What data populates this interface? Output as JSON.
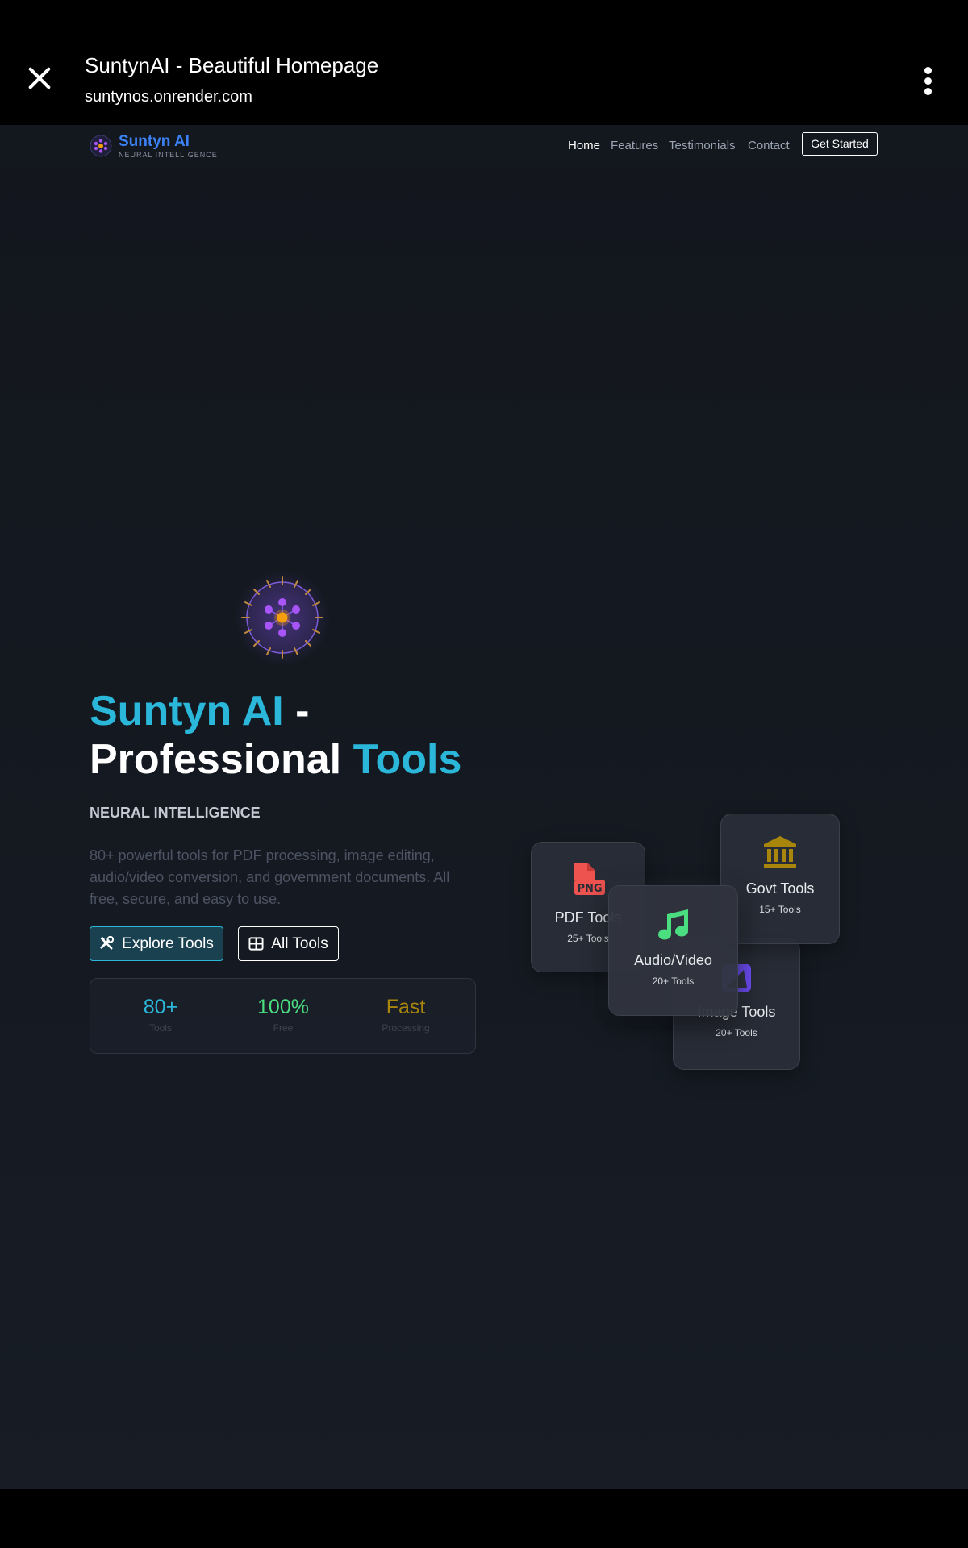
{
  "browser": {
    "title": "SuntynAI - Beautiful Homepage",
    "url": "suntynos.onrender.com"
  },
  "nav": {
    "brand_name": "Suntyn AI",
    "brand_sub": "NEURAL INTELLIGENCE",
    "links": [
      {
        "label": "Home",
        "active": true
      },
      {
        "label": "Features"
      },
      {
        "label": "Testimonials"
      },
      {
        "label": "Contact"
      }
    ],
    "cta": "Get Started"
  },
  "hero": {
    "title_part1": "Suntyn AI",
    "title_part2": " - ",
    "title_part3": "Professional ",
    "title_part4": "Tools",
    "subtitle": "NEURAL INTELLIGENCE",
    "description": "80+ powerful tools for PDF processing, image editing, audio/video conversion, and government documents. All free, secure, and easy to use.",
    "primary_button": "Explore Tools",
    "secondary_button": "All Tools"
  },
  "stats": [
    {
      "value": "80+",
      "label": "Tools",
      "color": "#2bb7d9"
    },
    {
      "value": "100%",
      "label": "Free",
      "color": "#4ade80"
    },
    {
      "value": "Fast",
      "label": "Processing",
      "color": "#a8860b"
    }
  ],
  "tool_cards": {
    "pdf": {
      "title": "PDF Tools",
      "count": "25+ Tools",
      "icon": "file-png-icon",
      "color": "#ef5350"
    },
    "image": {
      "title": "Image Tools",
      "count": "20+ Tools",
      "icon": "image-icon",
      "color": "#6d4cf5"
    },
    "govt": {
      "title": "Govt Tools",
      "count": "15+ Tools",
      "icon": "landmark-icon",
      "color": "#a8860b"
    },
    "audio": {
      "title": "Audio/Video",
      "count": "20+ Tools",
      "icon": "music-icon",
      "color": "#4ade80"
    }
  },
  "colors": {
    "accent": "#2bb7d9",
    "brand": "#3b82f6",
    "neural": "#8b5cf6"
  }
}
